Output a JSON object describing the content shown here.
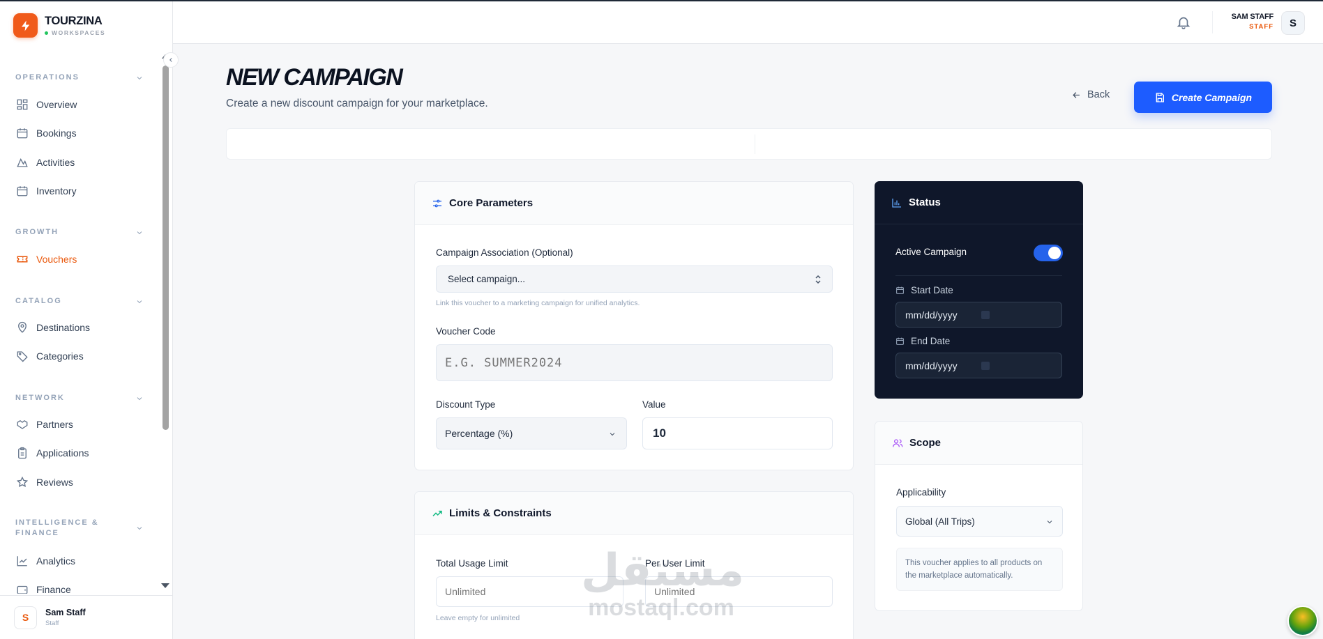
{
  "brand": {
    "name": "TOURZINA",
    "subtitle": "WORKSPACES"
  },
  "sidebar": {
    "sections": [
      {
        "label": "OPERATIONS",
        "items": [
          {
            "label": "Overview",
            "icon": "grid-icon"
          },
          {
            "label": "Bookings",
            "icon": "calendar-icon"
          },
          {
            "label": "Activities",
            "icon": "mountain-icon"
          },
          {
            "label": "Inventory",
            "icon": "calendar-icon"
          }
        ]
      },
      {
        "label": "GROWTH",
        "items": [
          {
            "label": "Vouchers",
            "icon": "ticket-icon",
            "active": true
          }
        ]
      },
      {
        "label": "CATALOG",
        "items": [
          {
            "label": "Destinations",
            "icon": "map-pin-icon"
          },
          {
            "label": "Categories",
            "icon": "tag-icon"
          }
        ]
      },
      {
        "label": "NETWORK",
        "items": [
          {
            "label": "Partners",
            "icon": "handshake-icon"
          },
          {
            "label": "Applications",
            "icon": "clipboard-icon"
          },
          {
            "label": "Reviews",
            "icon": "star-icon"
          }
        ]
      },
      {
        "label": "INTELLIGENCE &\nFINANCE",
        "items": [
          {
            "label": "Analytics",
            "icon": "chart-line-icon"
          },
          {
            "label": "Finance",
            "icon": "wallet-icon"
          }
        ]
      }
    ],
    "footer": {
      "avatar": "S",
      "name": "Sam Staff",
      "role": "Staff"
    }
  },
  "topbar": {
    "user_name": "SAM STAFF",
    "user_role": "STAFF",
    "avatar": "S"
  },
  "page": {
    "title": "NEW CAMPAIGN",
    "subtitle": "Create a new discount campaign for your marketplace.",
    "back_label": "Back",
    "create_label": "Create Campaign"
  },
  "core": {
    "title": "Core Parameters",
    "campaign_label": "Campaign Association (Optional)",
    "campaign_value": "Select campaign...",
    "campaign_hint": "Link this voucher to a marketing campaign for unified analytics.",
    "code_label": "Voucher Code",
    "code_placeholder": "E.G. SUMMER2024",
    "discount_label": "Discount Type",
    "discount_value": "Percentage (%)",
    "value_label": "Value",
    "value_value": "10"
  },
  "limits": {
    "title": "Limits & Constraints",
    "total_label": "Total Usage Limit",
    "total_placeholder": "Unlimited",
    "total_hint": "Leave empty for unlimited",
    "per_user_label": "Per User Limit",
    "per_user_placeholder": "Unlimited"
  },
  "status": {
    "title": "Status",
    "active_label": "Active Campaign",
    "active": true,
    "start_label": "Start Date",
    "start_value": "mm/dd/yyyy",
    "end_label": "End Date",
    "end_value": "mm/dd/yyyy"
  },
  "scope": {
    "title": "Scope",
    "applicability_label": "Applicability",
    "applicability_value": "Global (All Trips)",
    "note": "This voucher applies to all products on the marketplace automatically."
  },
  "watermark": {
    "arabic": "مستقل",
    "latin": "mostaql.com"
  },
  "colors": {
    "brand": "#f05a1a",
    "primary": "#1d5cff",
    "dark_card": "#0f172a"
  }
}
